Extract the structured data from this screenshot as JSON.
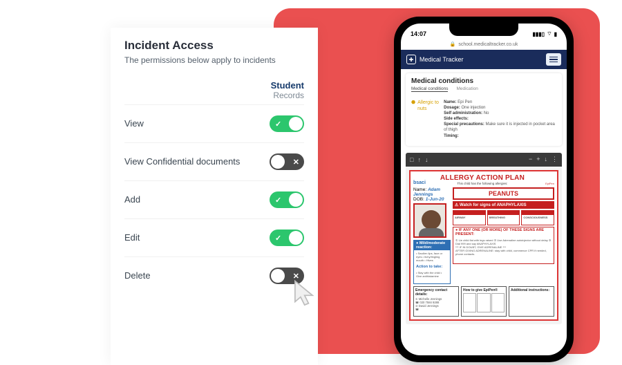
{
  "panel": {
    "title": "Incident Access",
    "subtitle": "The permissions below apply to incidents",
    "column": {
      "line1": "Student",
      "line2": "Records"
    },
    "rows": [
      {
        "label": "View",
        "on": true
      },
      {
        "label": "View Confidential documents",
        "on": false
      },
      {
        "label": "Add",
        "on": true
      },
      {
        "label": "Edit",
        "on": true
      },
      {
        "label": "Delete",
        "on": false
      }
    ],
    "glyph_on": "✓",
    "glyph_off": "✕"
  },
  "phone": {
    "time": "14:07",
    "url": "school.medicaltracker.co.uk",
    "brand": "Medical Tracker",
    "card_title": "Medical conditions",
    "tabs": {
      "a": "Medical conditions",
      "b": "Medication"
    },
    "allergy_label": "Allergic to nuts",
    "med": {
      "name_k": "Name:",
      "name_v": "Epi Pen",
      "dosage_k": "Dosage:",
      "dosage_v": "One injection",
      "self_k": "Self administration:",
      "self_v": "No",
      "side_k": "Side effects:",
      "prec_k": "Special precautions:",
      "prec_v": "Make sure it is injected in pocket area of thigh",
      "timing_k": "Timing:"
    },
    "pdf": {
      "tb_page": "□",
      "tb_up": "↑",
      "tb_down": "↓",
      "tb_minus": "−",
      "tb_plus": "+",
      "tb_dl": "↓",
      "tb_more": "⋮"
    },
    "plan": {
      "bsaci": "bsaci",
      "title": "ALLERGY ACTION PLAN",
      "sub": "This child has the following allergies:",
      "peanuts": "PEANUTS",
      "name_k": "Name:",
      "name_v": "Adam Jennings",
      "dob_k": "DOB:",
      "dob_v": "1-Jun-20",
      "anap": "⚠ Watch for signs of ANAPHYLAXIS",
      "c1": "AIRWAY",
      "c2": "BREATHING",
      "c3": "CONSCIOUSNESS",
      "mild_h": "● Mild/moderate reaction:",
      "mild_action": "Action to take:",
      "red_h": "● IF ANY ONE (OR MORE) OF THESE SIGNS ARE PRESENT:",
      "emer_t": "Emergency contact details:",
      "emer_1n": "Michelle Jennings",
      "emer_1p": "020 7584 9288",
      "emer_2n": "David Jennings",
      "howto_t": "How to give EpiPen®",
      "addl_t": "Additional instructions:"
    }
  }
}
